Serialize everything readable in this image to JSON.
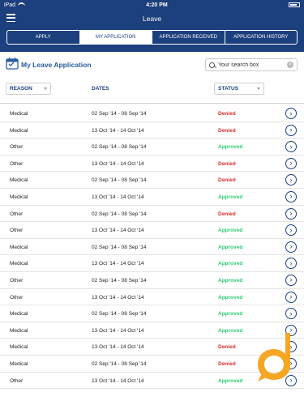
{
  "statusbar": {
    "carrier": "iPad",
    "time": "4:20 PM"
  },
  "header": {
    "title": "Leave"
  },
  "tabs": [
    {
      "label": "APPLY",
      "active": false
    },
    {
      "label": "MY APPLICATION",
      "active": true
    },
    {
      "label": "APPLICATION RECEIVED",
      "active": false
    },
    {
      "label": "APPLICATION HISTORY",
      "active": false
    }
  ],
  "page": {
    "title": "My Leave Application",
    "icon": "leave-calendar-icon"
  },
  "search": {
    "placeholder": "Your search box",
    "value": ""
  },
  "columns": {
    "reason": "REASON",
    "dates": "DATES",
    "status": "STATUS"
  },
  "colors": {
    "brand": "#1c3f7d",
    "denied": "#d92d2d",
    "approved": "#2ecc71",
    "accent": "#f5a623"
  },
  "rows": [
    {
      "reason": "Medical",
      "dates": "02 Sep '14 - 08 Sep '14",
      "status": "Denied"
    },
    {
      "reason": "Medical",
      "dates": "13 Oct '14 - 14 Oct '14",
      "status": "Denied"
    },
    {
      "reason": "Other",
      "dates": "02 Sep '14 - 08 Sep '14",
      "status": "Approved"
    },
    {
      "reason": "Other",
      "dates": "13 Oct '14 - 14 Oct '14",
      "status": "Denied"
    },
    {
      "reason": "Medical",
      "dates": "02 Sep '14 - 08 Sep '14",
      "status": "Denied"
    },
    {
      "reason": "Medical",
      "dates": "13 Oct '14 - 14 Oct '14",
      "status": "Approved"
    },
    {
      "reason": "Other",
      "dates": "02 Sep '14 - 08 Sep '14",
      "status": "Denied"
    },
    {
      "reason": "Other",
      "dates": "13 Oct '14 - 14 Oct '14",
      "status": "Approved"
    },
    {
      "reason": "Medical",
      "dates": "02 Sep '14 - 08 Sep '14",
      "status": "Approved"
    },
    {
      "reason": "Medical",
      "dates": "13 Oct '14 - 14 Oct '14",
      "status": "Approved"
    },
    {
      "reason": "Other",
      "dates": "02 Sep '14 - 08 Sep '14",
      "status": "Approved"
    },
    {
      "reason": "Other",
      "dates": "13 Oct '14 - 14 Oct '14",
      "status": "Approved"
    },
    {
      "reason": "Medical",
      "dates": "02 Sep '14 - 08 Sep '14",
      "status": "Approved"
    },
    {
      "reason": "Medical",
      "dates": "13 Oct '14 - 14 Oct '14",
      "status": "Approved"
    },
    {
      "reason": "Medical",
      "dates": "13 Oct '14 - 14 Oct '14",
      "status": "Denied"
    },
    {
      "reason": "Medical",
      "dates": "02 Sep '14 - 08 Sep '14",
      "status": "Denied"
    },
    {
      "reason": "Other",
      "dates": "13 Oct '14 - 14 Oct '14",
      "status": "Approved"
    }
  ]
}
